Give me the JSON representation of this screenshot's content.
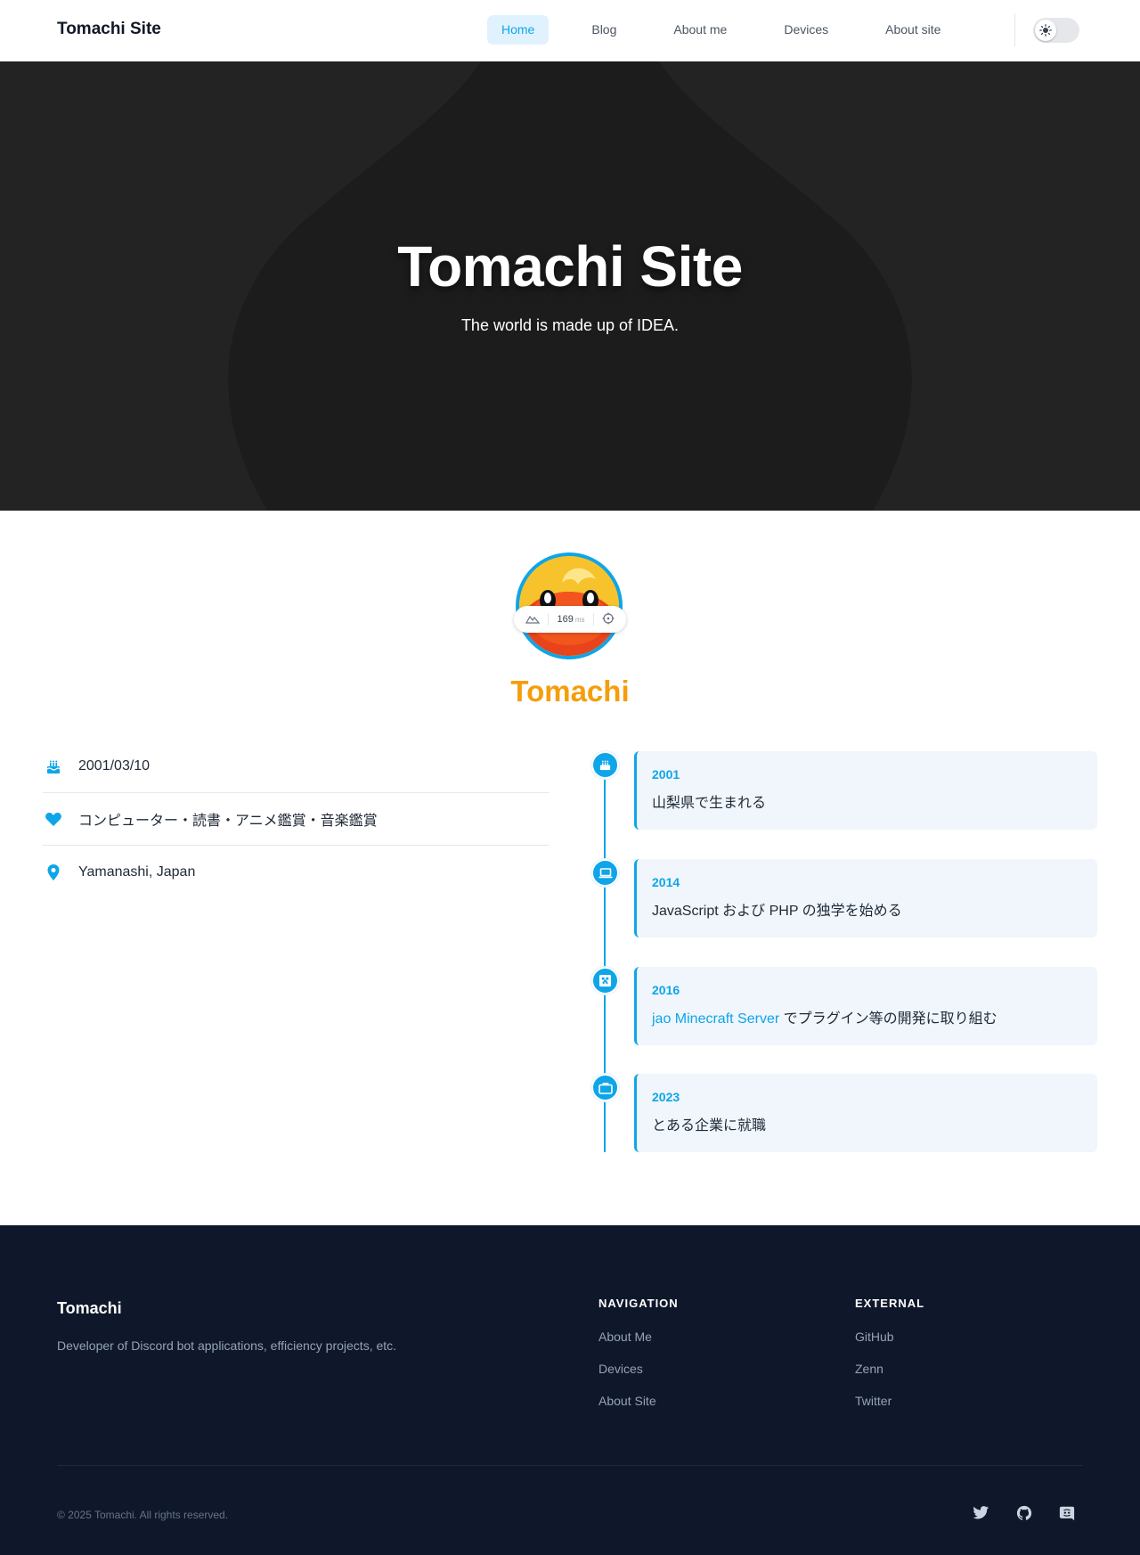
{
  "header": {
    "brand": "Tomachi Site",
    "nav": [
      "Home",
      "Blog",
      "About me",
      "Devices",
      "About site"
    ],
    "active_nav": "Home",
    "theme_icon": "sun-icon"
  },
  "hero": {
    "title": "Tomachi Site",
    "subtitle": "The world is made up of IDEA."
  },
  "profile": {
    "name": "Tomachi",
    "image_overlay": {
      "ms_value": "169",
      "ms_unit": "ms"
    },
    "info": [
      {
        "icon": "birthday-cake-icon",
        "text": "2001/03/10"
      },
      {
        "icon": "heart-icon",
        "text": "コンピューター・読書・アニメ鑑賞・音楽鑑賞"
      },
      {
        "icon": "location-pin-icon",
        "text": "Yamanashi, Japan"
      }
    ],
    "timeline": [
      {
        "icon": "cake-icon",
        "year": "2001",
        "text": "山梨県で生まれる"
      },
      {
        "icon": "laptop-icon",
        "year": "2014",
        "text": "JavaScript および PHP の独学を始める"
      },
      {
        "icon": "minecraft-icon",
        "year": "2016",
        "link": "jao Minecraft Server",
        "text": " でプラグイン等の開発に取り組む"
      },
      {
        "icon": "briefcase-icon",
        "year": "2023",
        "text": "とある企業に就職"
      }
    ]
  },
  "footer": {
    "brand": "Tomachi",
    "description": "Developer of Discord bot applications, efficiency projects, etc.",
    "navigation": {
      "heading": "NAVIGATION",
      "links": [
        "About Me",
        "Devices",
        "About Site"
      ]
    },
    "external": {
      "heading": "EXTERNAL",
      "links": [
        "GitHub",
        "Zenn",
        "Twitter"
      ]
    },
    "copyright": "© 2025 Tomachi. All rights reserved.",
    "social_icons": [
      "twitter-icon",
      "github-icon",
      "discord-icon"
    ]
  },
  "colors": {
    "accent": "#0ea5e9",
    "name": "#f59e0b",
    "hero_bg": "#232323",
    "footer_bg": "#0f172a"
  }
}
